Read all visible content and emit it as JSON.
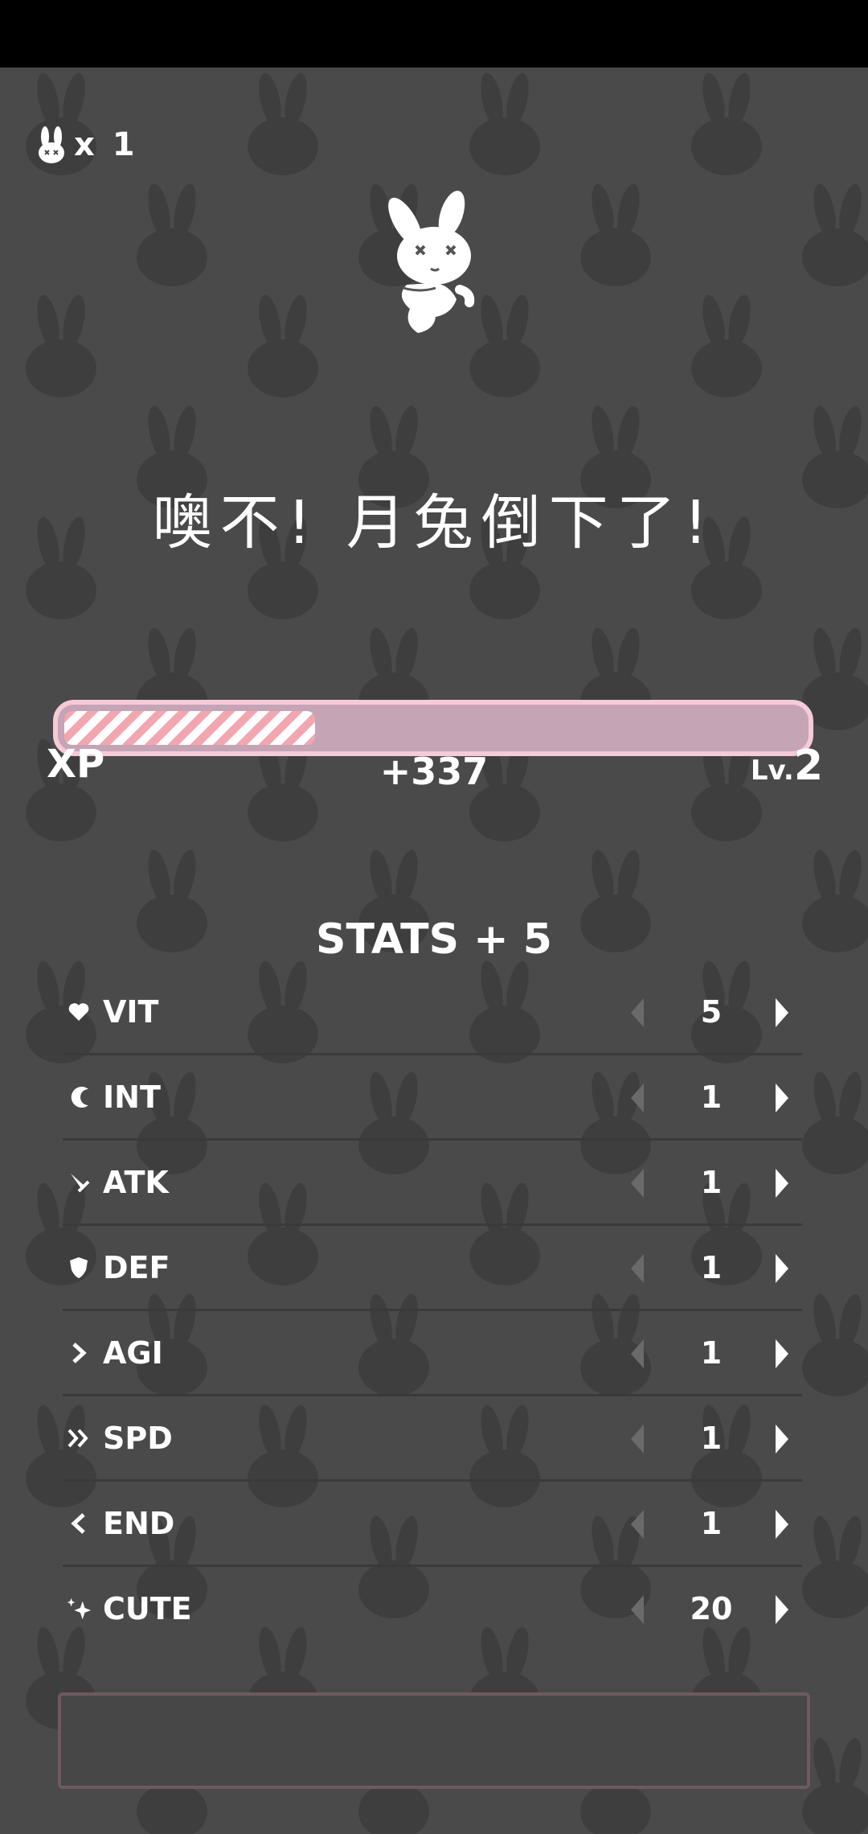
{
  "lives": {
    "icon": "bunny-icon",
    "count": "x 1"
  },
  "title": "噢不! 月兔倒下了!",
  "xp": {
    "label": "XP",
    "gain": "+337",
    "level_prefix": "Lv.",
    "level": "2",
    "progress": 0.34
  },
  "stats_title": "STATS + 5",
  "stats": [
    {
      "icon": "heart-icon",
      "name": "VIT",
      "value": "5"
    },
    {
      "icon": "moon-icon",
      "name": "INT",
      "value": "1"
    },
    {
      "icon": "sword-icon",
      "name": "ATK",
      "value": "1"
    },
    {
      "icon": "shield-icon",
      "name": "DEF",
      "value": "1"
    },
    {
      "icon": "agility-arrow-icon",
      "name": "AGI",
      "value": "1"
    },
    {
      "icon": "double-chevron-icon",
      "name": "SPD",
      "value": "1"
    },
    {
      "icon": "endurance-icon",
      "name": "END",
      "value": "1"
    },
    {
      "icon": "sparkle-icon",
      "name": "CUTE",
      "value": "20"
    }
  ],
  "colors": {
    "background": "#4a4a4a",
    "xp_border": "#f6cad7",
    "xp_track": "#c5a4b6",
    "xp_stripe": "#f2a7b0",
    "arrow_disabled": "#6a6a6a"
  }
}
